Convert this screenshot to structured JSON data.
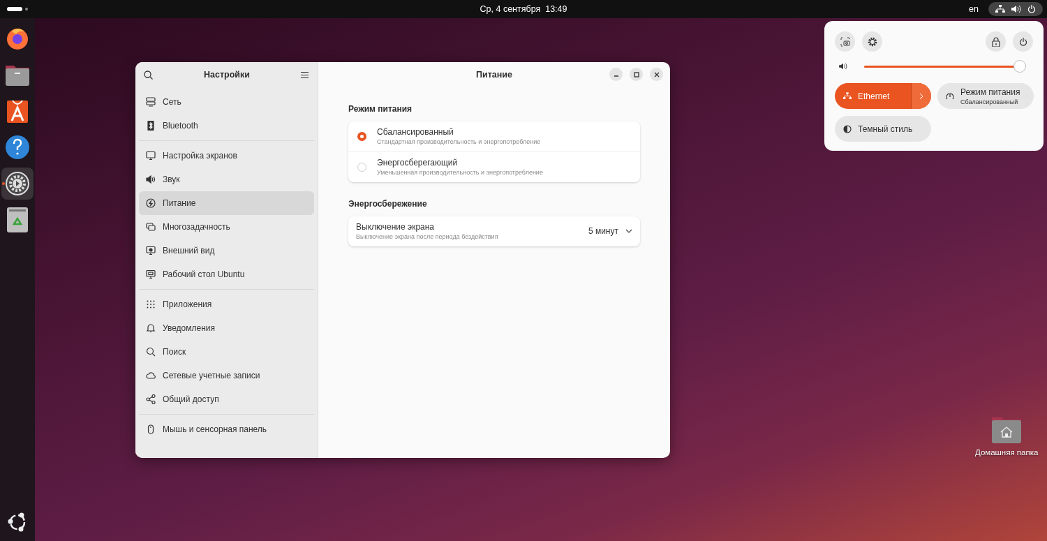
{
  "top_bar": {
    "clock": "Ср, 4 сентября  13:49",
    "keyboard_layout": "en"
  },
  "dock": {
    "items": [
      {
        "kind": "browser",
        "active": false
      },
      {
        "kind": "files",
        "active": false
      },
      {
        "kind": "store",
        "active": false
      },
      {
        "kind": "help",
        "active": false
      },
      {
        "kind": "settings",
        "active": true
      },
      {
        "kind": "trash",
        "active": false
      }
    ]
  },
  "settings_window": {
    "sidebar": {
      "title": "Настройки",
      "groups": [
        [
          {
            "label": "Сеть",
            "kind": "network",
            "selected": false
          },
          {
            "label": "Bluetooth",
            "kind": "bluetooth",
            "selected": false
          }
        ],
        [
          {
            "label": "Настройка экранов",
            "kind": "display",
            "selected": false
          },
          {
            "label": "Звук",
            "kind": "sound",
            "selected": false
          },
          {
            "label": "Питание",
            "kind": "power",
            "selected": true
          },
          {
            "label": "Многозадачность",
            "kind": "multitask",
            "selected": false
          },
          {
            "label": "Внешний вид",
            "kind": "appearance",
            "selected": false
          },
          {
            "label": "Рабочий стол Ubuntu",
            "kind": "desktop",
            "selected": false
          }
        ],
        [
          {
            "label": "Приложения",
            "kind": "apps",
            "selected": false
          },
          {
            "label": "Уведомления",
            "kind": "bell",
            "selected": false
          },
          {
            "label": "Поиск",
            "kind": "search",
            "selected": false
          },
          {
            "label": "Сетевые учетные записи",
            "kind": "cloud",
            "selected": false
          },
          {
            "label": "Общий доступ",
            "kind": "share",
            "selected": false
          }
        ],
        [
          {
            "label": "Мышь и сенсорная панель",
            "kind": "mouse",
            "selected": false
          }
        ]
      ]
    },
    "page": {
      "title": "Питание",
      "sections": [
        {
          "heading": "Режим питания",
          "kind": "radio",
          "rows": [
            {
              "title": "Сбалансированный",
              "subtitle": "Стандартная производительность и энергопотребление",
              "selected": true
            },
            {
              "title": "Энергосберегающий",
              "subtitle": "Уменьшенная производительность и энергопотребление",
              "selected": false
            }
          ]
        },
        {
          "heading": "Энергосбережение",
          "kind": "dropdown",
          "rows": [
            {
              "title": "Выключение экрана",
              "subtitle": "Выключение экрана после периода бездействия",
              "value": "5 минут"
            }
          ]
        }
      ]
    }
  },
  "quick_settings": {
    "volume": {
      "level": 0.97
    },
    "toggles": [
      {
        "kind": "network",
        "label": "Ethernet",
        "on": true,
        "expandable": true
      },
      {
        "kind": "power",
        "label": "Режим питания",
        "subtitle": "Сбалансированный",
        "on": false,
        "expandable": false
      },
      {
        "kind": "dark",
        "label": "Темный стиль",
        "on": false,
        "expandable": false
      }
    ]
  },
  "desktop_icons": [
    {
      "label": "Домашняя папка"
    }
  ]
}
